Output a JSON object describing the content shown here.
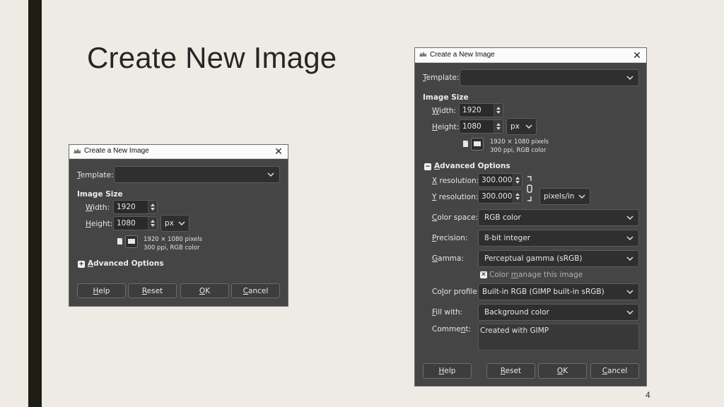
{
  "slide": {
    "title": "Create New Image",
    "page_number": "4"
  },
  "dialog_small": {
    "window_title": "Create a New Image",
    "template_label": "Template:",
    "image_size_label": "Image Size",
    "width_label": "Width:",
    "width_value": "1920",
    "height_label": "Height:",
    "height_value": "1080",
    "unit": "px",
    "info_line1": "1920 × 1080 pixels",
    "info_line2": "300 ppi, RGB color",
    "advanced_label": "Advanced Options",
    "advanced_toggle": "+",
    "buttons": {
      "help": "Help",
      "reset": "Reset",
      "ok": "OK",
      "cancel": "Cancel"
    }
  },
  "dialog_large": {
    "window_title": "Create a New Image",
    "template_label": "Template:",
    "image_size_label": "Image Size",
    "width_label": "Width:",
    "width_value": "1920",
    "height_label": "Height:",
    "height_value": "1080",
    "unit": "px",
    "info_line1": "1920 × 1080 pixels",
    "info_line2": "300 ppi, RGB color",
    "advanced_label": "Advanced Options",
    "advanced_toggle": "−",
    "x_res_label": "X resolution:",
    "x_res_value": "300.000",
    "y_res_label": "Y resolution:",
    "y_res_value": "300.000",
    "res_unit": "pixels/in",
    "color_space_label": "Color space:",
    "color_space_value": "RGB color",
    "precision_label": "Precision:",
    "precision_value": "8-bit integer",
    "gamma_label": "Gamma:",
    "gamma_value": "Perceptual gamma (sRGB)",
    "color_manage_label": "Color manage this image",
    "color_manage_checked": true,
    "color_profile_label": "Color profile:",
    "color_profile_value": "Built-in RGB (GIMP built-in sRGB)",
    "fill_label": "Fill with:",
    "fill_value": "Background color",
    "comment_label": "Comment:",
    "comment_value": "Created with GIMP",
    "buttons": {
      "help": "Help",
      "reset": "Reset",
      "ok": "OK",
      "cancel": "Cancel"
    }
  },
  "colors": {
    "background": "#edebe4",
    "sidebar": "#1e1e14",
    "dialog_body": "#454545",
    "field": "#2f2f2f"
  }
}
